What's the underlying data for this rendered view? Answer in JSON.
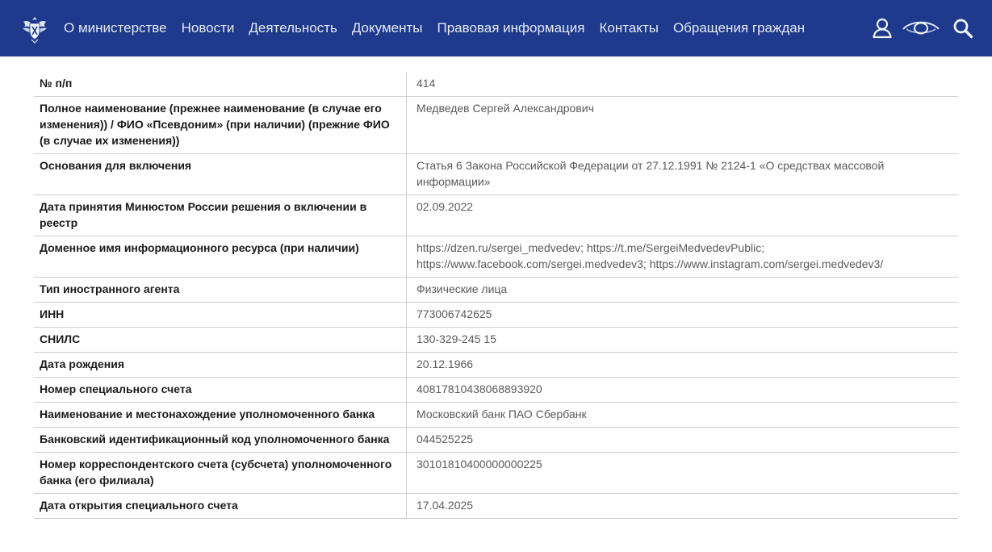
{
  "header": {
    "logo_alt": "Министерство юстиции",
    "nav": [
      "О министерстве",
      "Новости",
      "Деятельность",
      "Документы",
      "Правовая информация",
      "Контакты",
      "Обращения граждан"
    ],
    "icons": [
      "user-icon",
      "eye-icon",
      "search-icon"
    ],
    "colors": {
      "header_bg": "#1f3a8c",
      "nav_text": "#e3e9f7"
    }
  },
  "table": {
    "rows": [
      {
        "label": "№ п/п",
        "value": "414"
      },
      {
        "label": "Полное наименование (прежнее наименование (в случае его изменения)) / ФИО «Псевдоним» (при наличии) (прежние ФИО (в случае их изменения))",
        "value": "Медведев Сергей Александрович"
      },
      {
        "label": "Основания для включения",
        "value": "Статья 6 Закона Российской Федерации от 27.12.1991 № 2124-1 «О средствах массовой информации»"
      },
      {
        "label": "Дата принятия Минюстом России решения о включении в реестр",
        "value": "02.09.2022"
      },
      {
        "label": "Доменное имя информационного ресурса (при наличии)",
        "value": "https://dzen.ru/sergei_medvedev; https://t.me/SergeiMedvedevPublic; https://www.facebook.com/sergei.medvedev3; https://www.instagram.com/sergei.medvedev3/"
      },
      {
        "label": "Тип иностранного агента",
        "value": "Физические лица"
      },
      {
        "label": "ИНН",
        "value": "773006742625"
      },
      {
        "label": "СНИЛС",
        "value": "130-329-245 15"
      },
      {
        "label": "Дата рождения",
        "value": "20.12.1966"
      },
      {
        "label": "Номер специального счета",
        "value": "40817810438068893920"
      },
      {
        "label": "Наименование и местонахождение уполномоченного банка",
        "value": "Московский банк ПАО Сбербанк"
      },
      {
        "label": "Банковский идентификационный код уполномоченного банка",
        "value": "044525225"
      },
      {
        "label": "Номер корреспондентского счета (субсчета) уполномоченного банка (его филиала)",
        "value": "30101810400000000225"
      },
      {
        "label": "Дата открытия специального счета",
        "value": "17.04.2025"
      }
    ]
  }
}
